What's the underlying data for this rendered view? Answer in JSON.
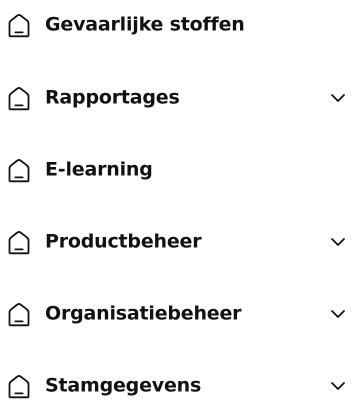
{
  "colors": {
    "text": "#121212",
    "background": "#ffffff"
  },
  "nav": {
    "items": [
      {
        "label": "Gevaarlijke stoffen",
        "icon": "home-icon",
        "expandable": false
      },
      {
        "label": "Rapportages",
        "icon": "home-icon",
        "expandable": true,
        "chevron": "chevron-down-icon"
      },
      {
        "label": "E-learning",
        "icon": "home-icon",
        "expandable": false
      },
      {
        "label": "Productbeheer",
        "icon": "home-icon",
        "expandable": true,
        "chevron": "chevron-down-icon"
      },
      {
        "label": "Organisatiebeheer",
        "icon": "home-icon",
        "expandable": true,
        "chevron": "chevron-down-icon"
      },
      {
        "label": "Stamgegevens",
        "icon": "home-icon",
        "expandable": true,
        "chevron": "chevron-down-icon"
      }
    ]
  }
}
